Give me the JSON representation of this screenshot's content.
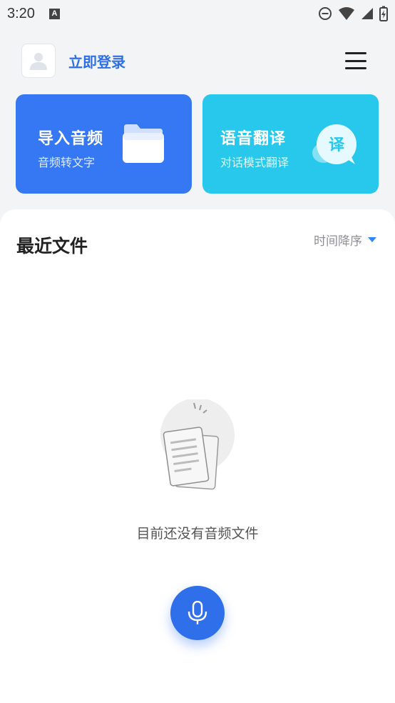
{
  "status_bar": {
    "time": "3:20",
    "notification_icon": "A"
  },
  "header": {
    "login_label": "立即登录"
  },
  "cards": {
    "import": {
      "title": "导入音频",
      "subtitle": "音频转文字"
    },
    "translate": {
      "title": "语音翻译",
      "subtitle": "对话模式翻译",
      "badge": "译"
    }
  },
  "recent": {
    "title": "最近文件",
    "sort_label": "时间降序",
    "empty_text": "目前还没有音频文件"
  },
  "colors": {
    "primary": "#2f6fea",
    "import_card": "#3678f4",
    "translate_card": "#27c8ec"
  },
  "icons": [
    "minus-circle-icon",
    "wifi-icon",
    "signal-icon",
    "battery-icon",
    "avatar-icon",
    "menu-icon",
    "folder-icon",
    "chat-bubble-icon",
    "document-icon",
    "microphone-icon"
  ]
}
